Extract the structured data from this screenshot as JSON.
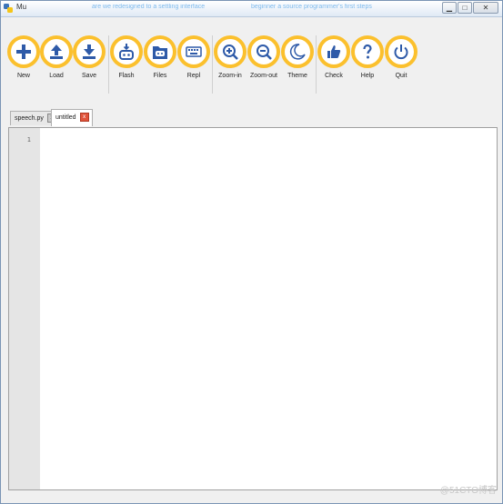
{
  "window": {
    "title": "Mu",
    "ghost_text_left": "are we redesigned to a settling interface",
    "ghost_text_right": "beginner a source programmer's first steps",
    "controls": {
      "minimize": "▁",
      "maximize": "□",
      "close": "✕"
    }
  },
  "toolbar": {
    "accent_color": "#fbc02d",
    "icon_color": "#2e5aa8",
    "buttons": [
      {
        "label": "New",
        "icon": "plus-icon"
      },
      {
        "label": "Load",
        "icon": "upload-icon"
      },
      {
        "label": "Save",
        "icon": "download-icon"
      },
      {
        "label": "Flash",
        "icon": "microbit-flash-icon"
      },
      {
        "label": "Files",
        "icon": "microbit-files-icon"
      },
      {
        "label": "Repl",
        "icon": "keyboard-icon"
      },
      {
        "label": "Zoom-in",
        "icon": "zoom-in-icon"
      },
      {
        "label": "Zoom-out",
        "icon": "zoom-out-icon"
      },
      {
        "label": "Theme",
        "icon": "moon-icon"
      },
      {
        "label": "Check",
        "icon": "thumbs-up-icon"
      },
      {
        "label": "Help",
        "icon": "question-icon"
      },
      {
        "label": "Quit",
        "icon": "power-icon"
      }
    ]
  },
  "tabs": [
    {
      "label": "speech.py",
      "active": false,
      "close": "x"
    },
    {
      "label": "untitled",
      "active": true,
      "close": "x"
    }
  ],
  "editor": {
    "line_numbers": [
      "1"
    ],
    "content": ""
  },
  "watermark": "@51CTO博客"
}
